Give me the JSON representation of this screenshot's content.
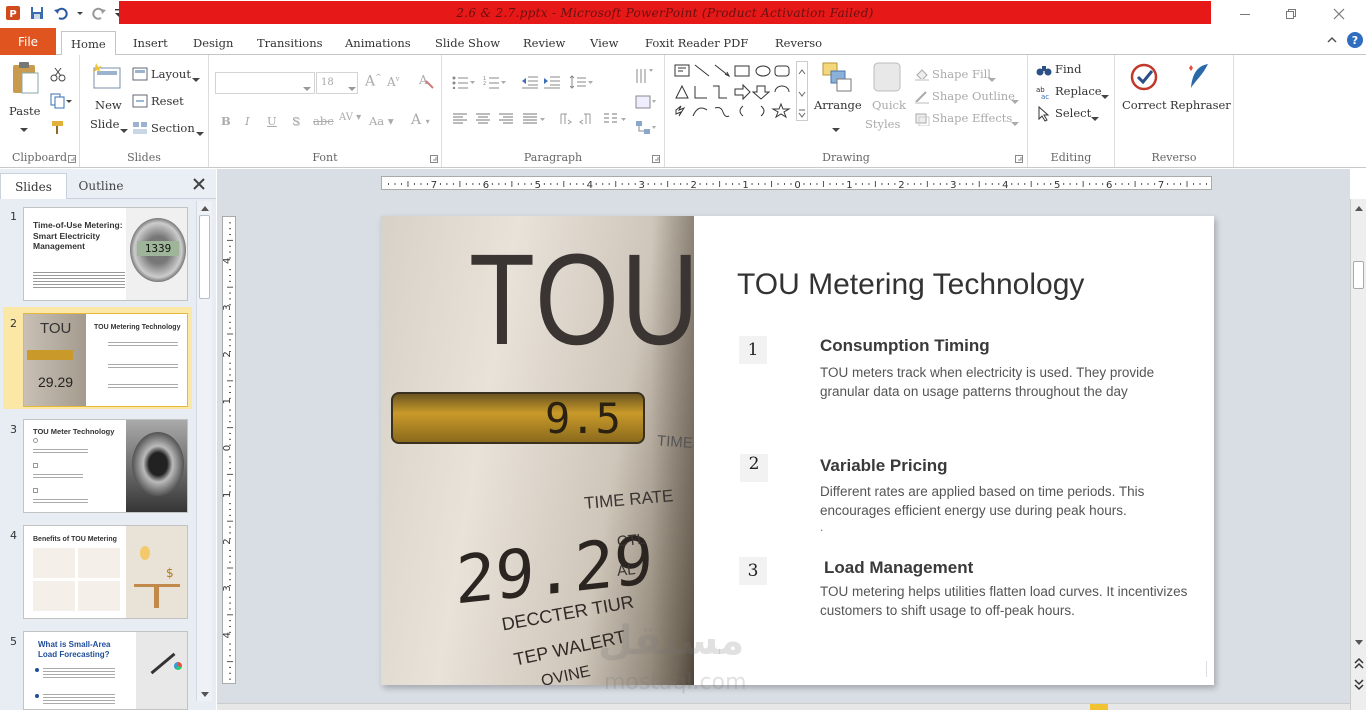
{
  "window": {
    "title": "2.6  & 2.7.pptx  -  Microsoft PowerPoint (Product Activation Failed)",
    "title_color": "#e61818"
  },
  "tabs": {
    "file": "File",
    "items": [
      "Home",
      "Insert",
      "Design",
      "Transitions",
      "Animations",
      "Slide Show",
      "Review",
      "View",
      "Foxit Reader PDF",
      "Reverso"
    ],
    "active": "Home"
  },
  "ribbon": {
    "clipboard": {
      "paste": "Paste",
      "label": "Clipboard"
    },
    "slides": {
      "new_slide_1": "New",
      "new_slide_2": "Slide",
      "layout": "Layout",
      "reset": "Reset",
      "section": "Section",
      "label": "Slides"
    },
    "font": {
      "size": "18",
      "label": "Font"
    },
    "paragraph": {
      "label": "Paragraph"
    },
    "drawing": {
      "arrange": "Arrange",
      "quick_styles_1": "Quick",
      "quick_styles_2": "Styles",
      "shape_fill": "Shape Fill",
      "shape_outline": "Shape Outline",
      "shape_effects": "Shape Effects",
      "label": "Drawing"
    },
    "editing": {
      "find": "Find",
      "replace": "Replace",
      "select": "Select",
      "label": "Editing"
    },
    "reverso": {
      "correct": "Correct",
      "rephraser": "Rephraser",
      "label": "Reverso"
    }
  },
  "panel": {
    "slides_tab": "Slides",
    "outline_tab": "Outline"
  },
  "thumbnails": [
    {
      "num": "1",
      "title": "Time-of-Use Metering: Smart Electricity Management",
      "meter": "1339"
    },
    {
      "num": "2",
      "title": "TOU Metering Technology"
    },
    {
      "num": "3",
      "title": "TOU Meter Technology"
    },
    {
      "num": "4",
      "title": "Benefits of TOU Metering"
    },
    {
      "num": "5",
      "title": "What is Small-Area Load Forecasting?"
    }
  ],
  "ruler": {
    "h_labels": [
      "7",
      "6",
      "5",
      "4",
      "3",
      "2",
      "1",
      "0",
      "1",
      "2",
      "3",
      "4",
      "5",
      "6",
      "7"
    ],
    "v_labels": [
      "4",
      "3",
      "2",
      "1",
      "0",
      "1",
      "2",
      "3",
      "4"
    ]
  },
  "slide": {
    "title": "TOU Metering Technology",
    "image_text": {
      "brand": "TOU",
      "display": "9.5",
      "times": "TIMES",
      "time_rate": "TIME RATE",
      "reading": "29.29",
      "ctl": "CTL",
      "al": "AL",
      "line1": "DECCTER TIUR",
      "line2": "TEP WALERT",
      "line3": "OVINE"
    },
    "items": [
      {
        "num": "1",
        "heading": "Consumption Timing",
        "body": "TOU meters track when electricity is used. They provide granular data on usage patterns throughout the day"
      },
      {
        "num": "2",
        "heading": "Variable Pricing",
        "body": "Different rates are applied based on time periods. This encourages efficient energy use during peak hours.",
        "extra": "."
      },
      {
        "num": "3",
        "heading": "Load Management",
        "body": "TOU metering helps utilities flatten load curves. It incentivizes  customers to shift usage to off-peak hours."
      }
    ]
  },
  "watermark": {
    "arabic": "مستقل",
    "latin": "mostaql.com"
  }
}
